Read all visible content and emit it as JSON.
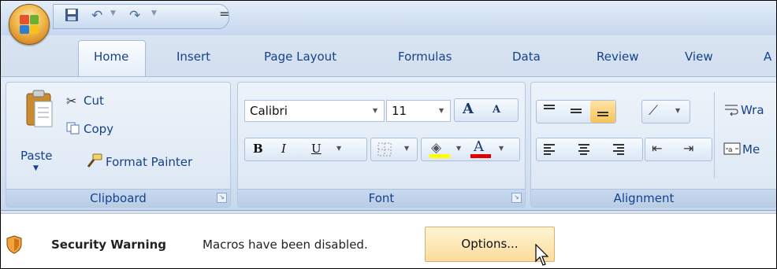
{
  "quick_access": {
    "customize_symbol": "="
  },
  "tabs": [
    "Home",
    "Insert",
    "Page Layout",
    "Formulas",
    "Data",
    "Review",
    "View",
    "A"
  ],
  "clipboard": {
    "paste": "Paste",
    "cut": "Cut",
    "copy": "Copy",
    "format_painter": "Format Painter",
    "group_label": "Clipboard"
  },
  "font": {
    "font_name": "Calibri",
    "font_size": "11",
    "grow": "A",
    "shrink": "A",
    "bold": "B",
    "italic": "I",
    "underline": "U",
    "font_color_letter": "A",
    "group_label": "Font"
  },
  "alignment": {
    "wrap_text": "Wra",
    "merge": "Me",
    "group_label": "Alignment"
  },
  "security": {
    "title": "Security Warning",
    "message": "Macros have been disabled.",
    "options_button": "Options..."
  },
  "colors": {
    "fill_highlight": "#ffff00",
    "font_color": "#e00000",
    "options_bg": "#fbdc9c"
  }
}
